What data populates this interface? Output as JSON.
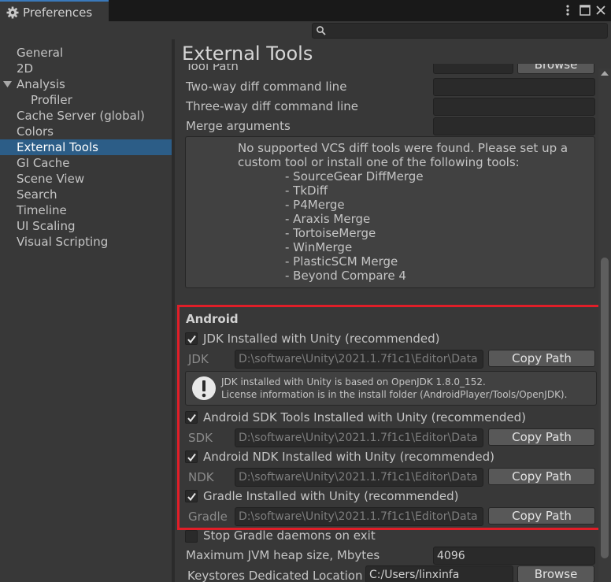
{
  "window": {
    "tab_title": "Preferences",
    "tab_icon": "gear-icon",
    "menu_icon": "kebab-menu-icon",
    "maximize_icon": "maximize-icon",
    "close_icon": "close-icon"
  },
  "search": {
    "placeholder": "",
    "value": ""
  },
  "sidebar": {
    "items": [
      {
        "label": "General"
      },
      {
        "label": "2D"
      },
      {
        "label": "Analysis",
        "expanded": true
      },
      {
        "label": "Profiler"
      },
      {
        "label": "Cache Server (global)"
      },
      {
        "label": "Colors"
      },
      {
        "label": "External Tools",
        "selected": true
      },
      {
        "label": "GI Cache"
      },
      {
        "label": "Scene View"
      },
      {
        "label": "Search"
      },
      {
        "label": "Timeline"
      },
      {
        "label": "UI Scaling"
      },
      {
        "label": "Visual Scripting"
      }
    ]
  },
  "main": {
    "title": "External Tools",
    "tool_path": {
      "label": "Tool Path",
      "button": "Browse"
    },
    "two_way": {
      "label": "Two-way diff command line"
    },
    "three_way": {
      "label": "Three-way diff command line"
    },
    "merge_args": {
      "label": "Merge arguments"
    },
    "vcs_info": [
      "No supported VCS diff tools were found. Please set up a",
      "custom tool or install one of the following tools:",
      "- SourceGear DiffMerge",
      "- TkDiff",
      "- P4Merge",
      "- Araxis Merge",
      "- TortoiseMerge",
      "- WinMerge",
      "- PlasticSCM Merge",
      "- Beyond Compare 4"
    ],
    "android": {
      "title": "Android",
      "jdk_check": "JDK Installed with Unity (recommended)",
      "jdk_label": "JDK",
      "jdk_path": "D:\\software\\Unity\\2021.1.7f1c1\\Editor\\Data",
      "copy_path": "Copy Path",
      "jdk_help_1": "JDK installed with Unity is based on OpenJDK 1.8.0_152.",
      "jdk_help_2": "License information is in the install folder (AndroidPlayer/Tools/OpenJDK).",
      "sdk_check": "Android SDK Tools Installed with Unity (recommended)",
      "sdk_label": "SDK",
      "sdk_path": "D:\\software\\Unity\\2021.1.7f1c1\\Editor\\Data",
      "ndk_check": "Android NDK Installed with Unity (recommended)",
      "ndk_label": "NDK",
      "ndk_path": "D:\\software\\Unity\\2021.1.7f1c1\\Editor\\Data",
      "gradle_check": "Gradle Installed with Unity (recommended)",
      "gradle_label": "Gradle",
      "gradle_path": "D:\\software\\Unity\\2021.1.7f1c1\\Editor\\Data",
      "stop_gradle": "Stop Gradle daemons on exit",
      "jvm_label": "Maximum JVM heap size, Mbytes",
      "jvm_value": "4096",
      "keystore_label": "Keystores Dedicated Location",
      "keystore_value": "C:/Users/linxinfa",
      "browse": "Browse"
    }
  },
  "colors": {
    "selected_bg": "#2c5d87",
    "highlight_border": "#e01e28",
    "tab_accent": "#3a79bb"
  }
}
